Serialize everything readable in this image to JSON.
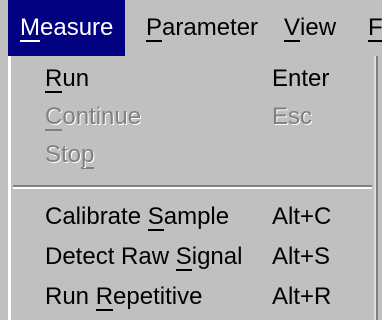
{
  "menubar": {
    "items": [
      {
        "before": "",
        "mnemonic": "M",
        "after": "easure",
        "selected": true
      },
      {
        "before": "",
        "mnemonic": "P",
        "after": "arameter",
        "selected": false
      },
      {
        "before": "",
        "mnemonic": "V",
        "after": "iew",
        "selected": false
      },
      {
        "before": "",
        "mnemonic": "F",
        "after": "",
        "selected": false
      }
    ]
  },
  "menu": {
    "items": [
      {
        "before": "",
        "mnemonic": "R",
        "after": "un",
        "shortcut": "Enter",
        "enabled": true
      },
      {
        "before": "",
        "mnemonic": "C",
        "after": "ontinue",
        "shortcut": "Esc",
        "enabled": false
      },
      {
        "before": "Sto",
        "mnemonic": "p",
        "after": "",
        "shortcut": "",
        "enabled": false
      },
      {
        "before": "Calibrate ",
        "mnemonic": "S",
        "after": "ample",
        "shortcut": "Alt+C",
        "enabled": true
      },
      {
        "before": "Detect Raw ",
        "mnemonic": "S",
        "after": "ignal",
        "shortcut": "Alt+S",
        "enabled": true
      },
      {
        "before": "Run ",
        "mnemonic": "R",
        "after": "epetitive",
        "shortcut": "Alt+R",
        "enabled": true
      }
    ]
  },
  "colors": {
    "face": "#c0c0c0",
    "highlight": "#000080",
    "disabled_text": "#808080"
  }
}
